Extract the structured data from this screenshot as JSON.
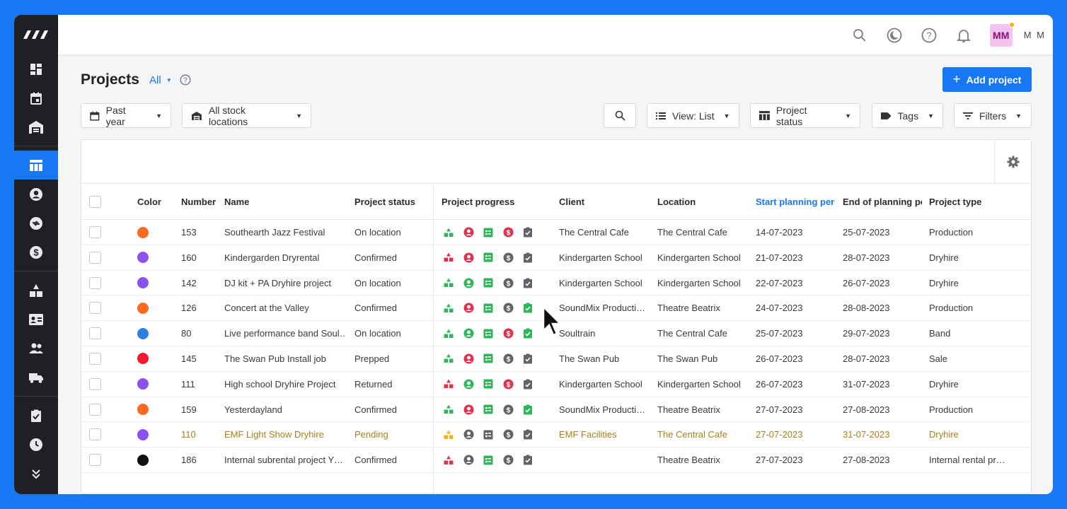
{
  "colors": {
    "accent": "#1877f2",
    "green": "#2fb65a",
    "red": "#e5304d",
    "grey": "#606368",
    "yellow": "#f2b01e",
    "pending_text": "#a8801a"
  },
  "topbar": {
    "icons": [
      "search-icon",
      "moon-icon",
      "help-icon",
      "bell-icon"
    ],
    "avatar_initials": "MM",
    "username": "M M"
  },
  "sidebar": {
    "items": [
      "dashboard-icon",
      "calendar-icon",
      "warehouse-icon",
      "projects-icon",
      "contact-icon",
      "sync-icon",
      "dollar-icon",
      "shapes-icon",
      "id-card-icon",
      "users-icon",
      "truck-icon",
      "task-icon",
      "clock-icon",
      "expand-icon"
    ],
    "active_index": 3
  },
  "header": {
    "title": "Projects",
    "filter_label": "All",
    "add_button": "Add project"
  },
  "toolbar": {
    "period": "Past year",
    "locations": "All stock locations",
    "view": "View: List",
    "status": "Project status",
    "tags": "Tags",
    "filters": "Filters"
  },
  "table": {
    "columns": {
      "color": "Color",
      "number": "Number",
      "name": "Name",
      "status": "Project status",
      "progress": "Project progress",
      "client": "Client",
      "location": "Location",
      "start": "Start planning perio",
      "end": "End of planning per",
      "type": "Project type"
    },
    "rows": [
      {
        "color": "#fb6a1e",
        "number": "153",
        "name": "Southearth Jazz Festival",
        "status": "On location",
        "client": "The Central Cafe",
        "location": "The Central Cafe",
        "start": "14-07-2023",
        "end": "25-07-2023",
        "type": "Production",
        "progress": [
          "green",
          "red",
          "green",
          "red",
          "grey"
        ]
      },
      {
        "color": "#8c52ee",
        "number": "160",
        "name": "Kindergarden Dryrental",
        "status": "Confirmed",
        "client": "Kindergarten School",
        "location": "Kindergarten School",
        "start": "21-07-2023",
        "end": "28-07-2023",
        "type": "Dryhire",
        "progress": [
          "red",
          "red",
          "green",
          "grey",
          "grey"
        ]
      },
      {
        "color": "#8c52ee",
        "number": "142",
        "name": "DJ kit + PA Dryhire project",
        "status": "On location",
        "client": "Kindergarten School",
        "location": "Kindergarten School",
        "start": "22-07-2023",
        "end": "26-07-2023",
        "type": "Dryhire",
        "progress": [
          "green",
          "green",
          "green",
          "grey",
          "grey"
        ]
      },
      {
        "color": "#fb6a1e",
        "number": "126",
        "name": "Concert at the Valley",
        "status": "Confirmed",
        "client": "SoundMix Producti…",
        "location": "Theatre Beatrix",
        "start": "24-07-2023",
        "end": "28-08-2023",
        "type": "Production",
        "progress": [
          "green",
          "red",
          "green",
          "grey",
          "green"
        ]
      },
      {
        "color": "#2f7fe0",
        "number": "80",
        "name": "Live performance band Soul…",
        "status": "On location",
        "client": "Soultrain",
        "location": "The Central Cafe",
        "start": "25-07-2023",
        "end": "29-07-2023",
        "type": "Band",
        "progress": [
          "green",
          "green",
          "green",
          "red",
          "green"
        ]
      },
      {
        "color": "#f21b2d",
        "number": "145",
        "name": "The Swan Pub Install job",
        "status": "Prepped",
        "client": "The Swan Pub",
        "location": "The Swan Pub",
        "start": "26-07-2023",
        "end": "28-07-2023",
        "type": "Sale",
        "progress": [
          "green",
          "red",
          "green",
          "grey",
          "grey"
        ]
      },
      {
        "color": "#8c52ee",
        "number": "111",
        "name": "High school Dryhire Project",
        "status": "Returned",
        "client": "Kindergarten School",
        "location": "Kindergarten School",
        "start": "26-07-2023",
        "end": "31-07-2023",
        "type": "Dryhire",
        "progress": [
          "red",
          "green",
          "green",
          "red",
          "grey"
        ]
      },
      {
        "color": "#fb6a1e",
        "number": "159",
        "name": "Yesterdayland",
        "status": "Confirmed",
        "client": "SoundMix Producti…",
        "location": "Theatre Beatrix",
        "start": "27-07-2023",
        "end": "27-08-2023",
        "type": "Production",
        "progress": [
          "green",
          "red",
          "green",
          "grey",
          "green"
        ]
      },
      {
        "color": "#8c52ee",
        "number": "110",
        "name": "EMF Light Show Dryhire",
        "status": "Pending",
        "client": "EMF Facilities",
        "location": "The Central Cafe",
        "start": "27-07-2023",
        "end": "31-07-2023",
        "type": "Dryhire",
        "pending": true,
        "progress": [
          "yellow",
          "grey",
          "grey",
          "grey",
          "grey"
        ]
      },
      {
        "color": "#111111",
        "number": "186",
        "name": "Internal subrental project Y…",
        "status": "Confirmed",
        "client": "",
        "location": "Theatre Beatrix",
        "start": "27-07-2023",
        "end": "27-08-2023",
        "type": "Internal rental pr…",
        "progress": [
          "red",
          "grey",
          "green",
          "grey",
          "grey"
        ]
      }
    ]
  }
}
